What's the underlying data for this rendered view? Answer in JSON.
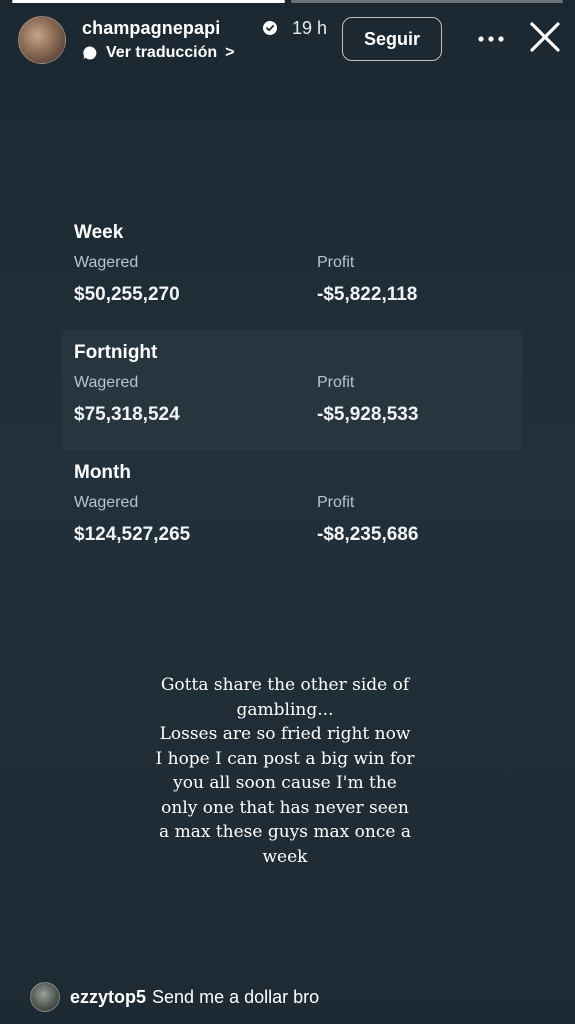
{
  "story": {
    "progress_segments": [
      1.0,
      0.0
    ]
  },
  "header": {
    "username": "champagnepapi",
    "timestamp": "19 h",
    "translate_label": "Ver traducción",
    "translate_chevron": ">",
    "follow_label": "Seguir",
    "more_label": "•••"
  },
  "stats": {
    "periods": [
      {
        "title": "Week",
        "wagered_label": "Wagered",
        "wagered_value": "$50,255,270",
        "profit_label": "Profit",
        "profit_value": "-$5,822,118"
      },
      {
        "title": "Fortnight",
        "wagered_label": "Wagered",
        "wagered_value": "$75,318,524",
        "profit_label": "Profit",
        "profit_value": "-$5,928,533"
      },
      {
        "title": "Month",
        "wagered_label": "Wagered",
        "wagered_value": "$124,527,265",
        "profit_label": "Profit",
        "profit_value": "-$8,235,686"
      }
    ]
  },
  "caption": {
    "lines": [
      "Gotta share the other side of",
      "gambling...",
      "Losses are so fried right now",
      "I hope I can post a big win for",
      "you all soon cause I'm the",
      "only one that has never seen",
      "a max these guys max once a",
      "week"
    ]
  },
  "comment": {
    "username": "ezzytop5",
    "text": "Send me a dollar bro"
  }
}
